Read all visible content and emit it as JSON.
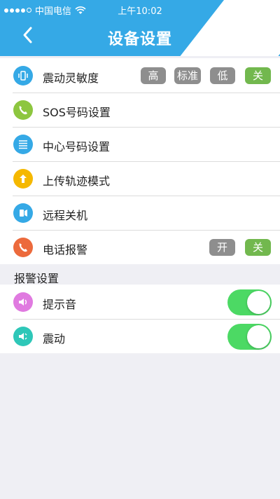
{
  "status_bar": {
    "carrier": "中国电信",
    "time": "上午10:02"
  },
  "header": {
    "title": "设备设置"
  },
  "settings": {
    "vibration_sensitivity": {
      "label": "震动灵敏度",
      "options": [
        "高",
        "标准",
        "低",
        "关"
      ],
      "selected": "关"
    },
    "sos_number": {
      "label": "SOS号码设置"
    },
    "center_number": {
      "label": "中心号码设置"
    },
    "upload_mode": {
      "label": "上传轨迹模式"
    },
    "remote_shutdown": {
      "label": "远程关机"
    },
    "phone_alarm": {
      "label": "电话报警",
      "options": [
        "开",
        "关"
      ],
      "selected": "关"
    }
  },
  "alarm_section": {
    "title": "报警设置",
    "items": [
      {
        "label": "提示音",
        "enabled": true
      },
      {
        "label": "震动",
        "enabled": true
      }
    ]
  },
  "colors": {
    "accent": "#35a9e6",
    "selected": "#72b84e",
    "unselected": "#8e8e8e",
    "toggle_on": "#4cd964"
  },
  "icons": [
    "vibrate-icon",
    "phone-call-icon",
    "list-icon",
    "upload-arrow-icon",
    "shutdown-icon",
    "phone-alarm-icon",
    "speaker-icon",
    "vibration-speaker-icon"
  ]
}
